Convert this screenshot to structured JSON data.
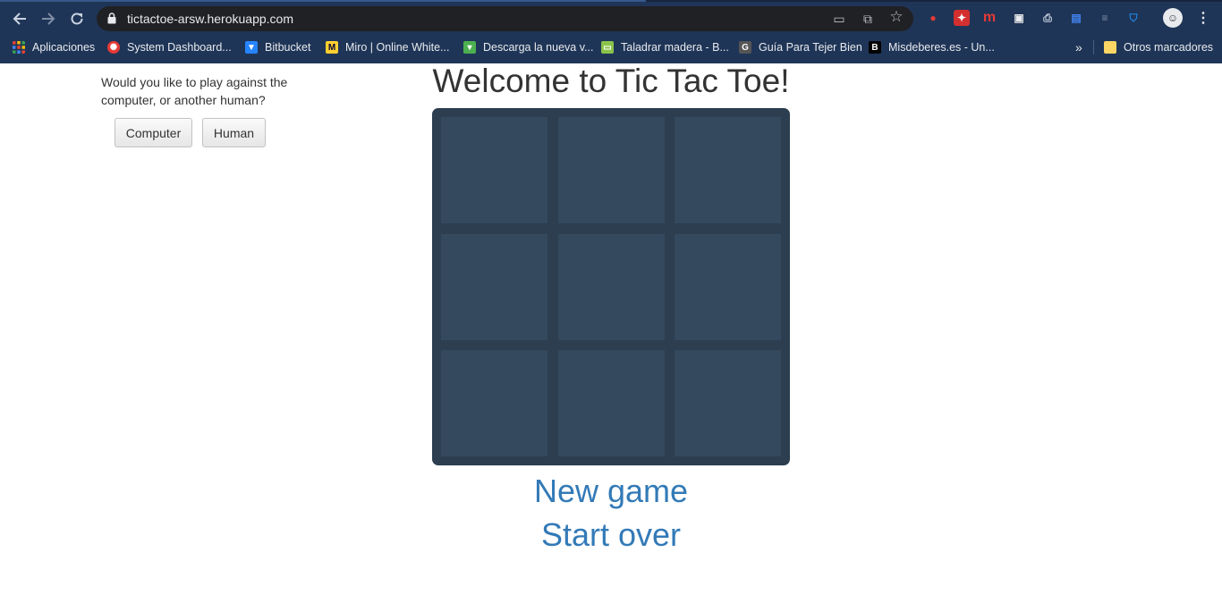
{
  "browser": {
    "url": "tictactoe-arsw.herokuapp.com",
    "bookmarks": [
      {
        "label": "Aplicaciones",
        "icon": "apps-grid-icon"
      },
      {
        "label": "System Dashboard...",
        "icon": "dashboard-icon"
      },
      {
        "label": "Bitbucket",
        "icon": "bitbucket-icon"
      },
      {
        "label": "Miro | Online White...",
        "icon": "miro-icon"
      },
      {
        "label": "Descarga la nueva v...",
        "icon": "download-icon"
      },
      {
        "label": "Taladrar madera - B...",
        "icon": "tv-icon"
      },
      {
        "label": "Guía Para Tejer Bien",
        "icon": "g-icon"
      },
      {
        "label": "Misdeberes.es - Un...",
        "icon": "b-icon"
      }
    ],
    "more_bookmarks": "»",
    "other_bookmarks": "Otros marcadores"
  },
  "page": {
    "question": "Would you like to play against the computer, or another human?",
    "computer_button": "Computer",
    "human_button": "Human",
    "title": "Welcome to Tic Tac Toe!",
    "new_game": "New game",
    "start_over": "Start over"
  },
  "board": {
    "cells": [
      "",
      "",
      "",
      "",
      "",
      "",
      "",
      "",
      ""
    ]
  },
  "colors": {
    "browser_bg": "#1f3557",
    "board_bg": "#2c3e50",
    "cell_bg": "#34495e",
    "link": "#337ab7"
  }
}
